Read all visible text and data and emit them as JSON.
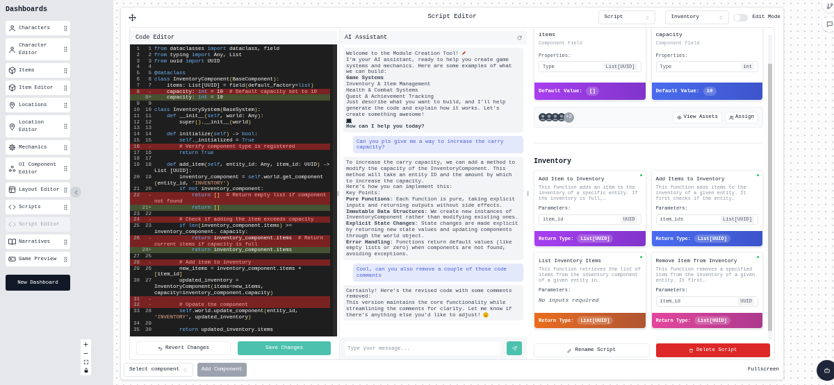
{
  "sidebar": {
    "title": "Dashboards",
    "items": [
      {
        "label": "Characters",
        "selected": false
      },
      {
        "label": "Character Editor",
        "selected": false
      },
      {
        "label": "Items",
        "selected": false
      },
      {
        "label": "Item Editor",
        "selected": false
      },
      {
        "label": "Locations",
        "selected": false
      },
      {
        "label": "Location Editor",
        "selected": false
      },
      {
        "label": "Mechanics",
        "selected": false
      },
      {
        "label": "UI Component Editor",
        "selected": false
      },
      {
        "label": "Layout Editor",
        "selected": false
      },
      {
        "label": "Scripts",
        "selected": false
      },
      {
        "label": "Script Editor",
        "selected": true
      },
      {
        "label": "Narratives",
        "selected": false
      },
      {
        "label": "Game Preview",
        "selected": false
      }
    ],
    "new_button": "New Dashboard"
  },
  "window": {
    "title": "Script Editor",
    "selects": [
      "Script",
      "Inventory"
    ],
    "edit_mode": {
      "label": "Edit Mode",
      "on": false
    }
  },
  "code_editor": {
    "title": "Code Editor",
    "lines": [
      {
        "old": "1",
        "new": "1",
        "kind": "context",
        "code": [
          {
            "kind": "keyword",
            "text": "from"
          },
          {
            "kind": "plain",
            "text": " dataclasses "
          },
          {
            "kind": "keyword",
            "text": "import"
          },
          {
            "kind": "plain",
            "text": " dataclass, field"
          }
        ]
      },
      {
        "old": "2",
        "new": "2",
        "kind": "context",
        "code": [
          {
            "kind": "keyword",
            "text": "from"
          },
          {
            "kind": "plain",
            "text": " typing "
          },
          {
            "kind": "keyword",
            "text": "import"
          },
          {
            "kind": "plain",
            "text": " Any, List"
          }
        ]
      },
      {
        "old": "3",
        "new": "3",
        "kind": "context",
        "code": [
          {
            "kind": "keyword",
            "text": "from"
          },
          {
            "kind": "plain",
            "text": " uuid "
          },
          {
            "kind": "keyword",
            "text": "import"
          },
          {
            "kind": "plain",
            "text": " UUID"
          }
        ]
      },
      {
        "old": "4",
        "new": "4",
        "kind": "context"
      },
      {
        "old": "5",
        "new": "5",
        "kind": "context",
        "code": [
          {
            "kind": "keyword",
            "text": "@dataclass"
          }
        ]
      },
      {
        "old": "6",
        "new": "6",
        "kind": "context",
        "code": [
          {
            "kind": "keyword",
            "text": "class"
          },
          {
            "kind": "plain",
            "text": " InventoryComponent"
          },
          {
            "kind": "bracket",
            "text": "("
          },
          {
            "kind": "plain",
            "text": "BaseComponent"
          },
          {
            "kind": "bracket",
            "text": ")"
          },
          {
            "kind": "plain",
            "text": ":"
          }
        ]
      },
      {
        "old": "7",
        "new": "7",
        "kind": "context",
        "code": [
          {
            "kind": "plain",
            "text": "    items: List[UUID] = field"
          },
          {
            "kind": "bracket",
            "text": "("
          },
          {
            "kind": "plain",
            "text": "default_factory="
          },
          {
            "kind": "keyword",
            "text": "list"
          },
          {
            "kind": "bracket",
            "text": ")"
          }
        ]
      },
      {
        "old": "8",
        "new": "-",
        "kind": "removed",
        "code": [
          {
            "kind": "plain",
            "text": "    capacity: "
          },
          {
            "kind": "keyword",
            "text": "int"
          },
          {
            "kind": "plain",
            "text": " = 10  "
          },
          {
            "kind": "comment",
            "text": "# Default capacity set to 10"
          }
        ]
      },
      {
        "new": "8+",
        "kind": "added",
        "code": [
          {
            "kind": "plain",
            "text": "    capacity: "
          },
          {
            "kind": "keyword",
            "text": "int"
          },
          {
            "kind": "plain",
            "text": " = 10"
          }
        ]
      },
      {
        "old": "9",
        "new": "9",
        "kind": "context"
      },
      {
        "old": "10",
        "new": "10",
        "kind": "context",
        "code": [
          {
            "kind": "keyword",
            "text": "class"
          },
          {
            "kind": "plain",
            "text": " InventorySystem"
          },
          {
            "kind": "bracket",
            "text": "("
          },
          {
            "kind": "plain",
            "text": "BaseSystem"
          },
          {
            "kind": "bracket",
            "text": ")"
          },
          {
            "kind": "plain",
            "text": ":"
          }
        ]
      },
      {
        "old": "11",
        "new": "11",
        "kind": "context",
        "code": [
          {
            "kind": "keyword",
            "text": "    def"
          },
          {
            "kind": "plain",
            "text": " __init__"
          },
          {
            "kind": "bracket",
            "text": "("
          },
          {
            "kind": "keyword",
            "text": "self"
          },
          {
            "kind": "plain",
            "text": ", world: Any"
          },
          {
            "kind": "bracket",
            "text": ")"
          },
          {
            "kind": "plain",
            "text": ":"
          }
        ]
      },
      {
        "old": "12",
        "new": "12",
        "kind": "context",
        "code": [
          {
            "kind": "plain",
            "text": "        super"
          },
          {
            "kind": "bracket",
            "text": "()"
          },
          {
            "kind": "plain",
            "text": ".__init__"
          },
          {
            "kind": "bracket",
            "text": "("
          },
          {
            "kind": "plain",
            "text": "world"
          },
          {
            "kind": "bracket",
            "text": ")"
          }
        ]
      },
      {
        "old": "13",
        "new": "13",
        "kind": "context"
      },
      {
        "old": "14",
        "new": "14",
        "kind": "context",
        "code": [
          {
            "kind": "keyword",
            "text": "    def"
          },
          {
            "kind": "plain",
            "text": " initialize"
          },
          {
            "kind": "bracket",
            "text": "("
          },
          {
            "kind": "keyword",
            "text": "self"
          },
          {
            "kind": "bracket",
            "text": ")"
          },
          {
            "kind": "plain",
            "text": " -> "
          },
          {
            "kind": "keyword",
            "text": "bool"
          },
          {
            "kind": "plain",
            "text": ":"
          }
        ]
      },
      {
        "old": "15",
        "new": "15",
        "kind": "context",
        "code": [
          {
            "kind": "keyword",
            "text": "        self"
          },
          {
            "kind": "plain",
            "text": "._initialized = "
          },
          {
            "kind": "keyword",
            "text": "True"
          }
        ]
      },
      {
        "old": "16",
        "new": "-",
        "kind": "removed",
        "code": [
          {
            "kind": "comment",
            "text": "        # Verify component type is registered"
          }
        ]
      },
      {
        "old": "17",
        "new": "16",
        "kind": "context",
        "code": [
          {
            "kind": "keyword",
            "text": "        return True"
          }
        ]
      },
      {
        "old": "18",
        "new": "17",
        "kind": "context"
      },
      {
        "old": "19",
        "new": "18",
        "kind": "context",
        "code": [
          {
            "kind": "keyword",
            "text": "    def"
          },
          {
            "kind": "plain",
            "text": " add_item"
          },
          {
            "kind": "bracket",
            "text": "("
          },
          {
            "kind": "keyword",
            "text": "self"
          },
          {
            "kind": "plain",
            "text": ", entity_id: Any, item_id: UUID"
          },
          {
            "kind": "bracket",
            "text": ")"
          },
          {
            "kind": "plain",
            "text": " -> List [UUID]:"
          }
        ]
      },
      {
        "old": "20",
        "new": "19",
        "kind": "context",
        "code": [
          {
            "kind": "plain",
            "text": "        inventory_component = "
          },
          {
            "kind": "keyword",
            "text": "self"
          },
          {
            "kind": "plain",
            "text": ".world.get_component "
          },
          {
            "kind": "bracket",
            "text": "("
          },
          {
            "kind": "plain",
            "text": "entity_id, "
          },
          {
            "kind": "string",
            "text": "'INVENTORY'"
          },
          {
            "kind": "bracket",
            "text": ")"
          }
        ]
      },
      {
        "old": "21",
        "new": "20",
        "kind": "context",
        "code": [
          {
            "kind": "keyword",
            "text": "        if not"
          },
          {
            "kind": "plain",
            "text": " inventory_component:"
          }
        ]
      },
      {
        "old": "22",
        "new": "-",
        "kind": "removed",
        "code": [
          {
            "kind": "keyword",
            "text": "            return"
          },
          {
            "kind": "bracket",
            "text": " []"
          },
          {
            "kind": "comment",
            "text": "  # Return empty list if component not found"
          }
        ]
      },
      {
        "new": "21+",
        "kind": "added",
        "code": [
          {
            "kind": "keyword",
            "text": "            return"
          },
          {
            "kind": "bracket",
            "text": " []"
          }
        ]
      },
      {
        "old": "23",
        "new": "22",
        "kind": "context"
      },
      {
        "old": "24",
        "new": "-",
        "kind": "removed",
        "code": [
          {
            "kind": "comment",
            "text": "        # Check if adding the item exceeds capacity"
          }
        ]
      },
      {
        "old": "25",
        "new": "23",
        "kind": "context",
        "code": [
          {
            "kind": "keyword",
            "text": "        if len"
          },
          {
            "kind": "bracket",
            "text": "("
          },
          {
            "kind": "plain",
            "text": "inventory_component.items"
          },
          {
            "kind": "bracket",
            "text": ")"
          },
          {
            "kind": "plain",
            "text": " >= inventory_component. capacity:"
          }
        ]
      },
      {
        "old": "26",
        "new": "-",
        "kind": "removed",
        "code": [
          {
            "kind": "keyword",
            "text": "            return"
          },
          {
            "kind": "plain",
            "text": " inventory_component.items"
          },
          {
            "kind": "comment",
            "text": "  # Return current items if capacity is full"
          }
        ]
      },
      {
        "new": "24+",
        "kind": "added",
        "code": [
          {
            "kind": "keyword",
            "text": "            return"
          },
          {
            "kind": "plain",
            "text": " inventory_component.items"
          }
        ]
      },
      {
        "old": "27",
        "new": "25",
        "kind": "context"
      },
      {
        "old": "28",
        "new": "-",
        "kind": "removed",
        "code": [
          {
            "kind": "comment",
            "text": "        # Add item to inventory"
          }
        ]
      },
      {
        "old": "29",
        "new": "26",
        "kind": "context",
        "code": [
          {
            "kind": "plain",
            "text": "        new_items = inventory_component.items + "
          },
          {
            "kind": "bracket",
            "text": "["
          },
          {
            "kind": "plain",
            "text": "item_id"
          },
          {
            "kind": "bracket",
            "text": "]"
          }
        ]
      },
      {
        "old": "30",
        "new": "27",
        "kind": "context",
        "code": [
          {
            "kind": "plain",
            "text": "        updated_inventory = InventoryComponent"
          },
          {
            "kind": "bracket",
            "text": "("
          },
          {
            "kind": "plain",
            "text": "items=new_items, capacity=inventory_component.capacity"
          },
          {
            "kind": "bracket",
            "text": ")"
          }
        ]
      },
      {
        "old": "31",
        "new": "-",
        "kind": "removed"
      },
      {
        "old": "32",
        "new": "-",
        "kind": "removed",
        "code": [
          {
            "kind": "comment",
            "text": "        # Update the component"
          }
        ]
      },
      {
        "old": "33",
        "new": "28",
        "kind": "context",
        "code": [
          {
            "kind": "keyword",
            "text": "        self"
          },
          {
            "kind": "plain",
            "text": ".world.update_component"
          },
          {
            "kind": "bracket",
            "text": "("
          },
          {
            "kind": "plain",
            "text": "entity_id, "
          },
          {
            "kind": "string",
            "text": "'INVENTORY'"
          },
          {
            "kind": "plain",
            "text": ", updated_inventory"
          },
          {
            "kind": "bracket",
            "text": ")"
          }
        ]
      },
      {
        "old": "34",
        "new": "29",
        "kind": "context"
      },
      {
        "old": "35",
        "new": "30",
        "kind": "context",
        "code": [
          {
            "kind": "keyword",
            "text": "        return"
          },
          {
            "kind": "plain",
            "text": " updated_inventory.items"
          }
        ]
      }
    ],
    "buttons": [
      "Revert Changes",
      "Save Changes"
    ]
  },
  "ai_assistant": {
    "title": "AI Assistant",
    "messages": [
      {
        "kind": "assistant",
        "paragraphs": [
          {
            "kind": "text",
            "text": "Welcome to the Module Creation Tool!",
            "emoji": true
          },
          {
            "kind": "text",
            "text": "I'm your AI assistant, ready to help you create game systems and mechanics. Here are some examples of what we can build:"
          },
          {
            "kind": "heading",
            "text": "Game Systems"
          },
          {
            "kind": "text",
            "text": "Inventory & Item Management"
          },
          {
            "kind": "text",
            "text": "Health & Combat Systems"
          },
          {
            "kind": "text",
            "text": "Quest & Achievement Tracking"
          },
          {
            "kind": "text",
            "text": "Just describe what you want to build, and I'll help generate the code and explain how it works. Let's create something awesome!",
            "emoji": true
          },
          {
            "kind": "heading",
            "text": "How can I help you today?"
          }
        ]
      },
      {
        "kind": "user",
        "paragraphs": [
          {
            "kind": "text",
            "text": "Can you pls give me a way to increase the carry capacity?"
          }
        ]
      },
      {
        "kind": "assistant",
        "paragraphs": [
          {
            "kind": "text",
            "text": "To increase the carry capacity, we can add a method to modify the capacity of the InventoryComponent. This method will take an entity ID and the amount by which to increase the capacity."
          },
          {
            "kind": "text",
            "text": "Here's how you can implement this:"
          },
          {
            "kind": "text",
            "text": "Key Points:"
          },
          {
            "kind": "text",
            "text": "**Pure Functions**: Each function is pure, taking explicit inputs and returning outputs without side effects."
          },
          {
            "kind": "text",
            "text": "**Immutable Data Structures**: We create new instances of InventoryComponent rather than modifying existing ones."
          },
          {
            "kind": "text",
            "text": "**Explicit State Changes**: State changes are made explicit by returning new state values and updating components through the world object."
          },
          {
            "kind": "text",
            "text": "**Error Handling**: Functions return default values (like empty lists or zero) when components are not found, avoiding exceptions."
          }
        ]
      },
      {
        "kind": "user",
        "paragraphs": [
          {
            "kind": "text",
            "text": "Cool, can you also remove a couple of those code comments"
          }
        ]
      },
      {
        "kind": "assistant",
        "paragraphs": [
          {
            "kind": "text",
            "text": "Certainly! Here's the revised code with some comments removed:"
          },
          {
            "kind": "text",
            "text": "This version maintains the core functionality while streamlining the comments for clarity. Let me know if there's anything else you'd like to adjust!",
            "emoji": true
          }
        ]
      }
    ],
    "input": {
      "placeholder": "Type your message..."
    }
  },
  "script_panel": {
    "fields": [
      {
        "name": "items",
        "subtitle": "Component Field",
        "properties_label": "Properties:",
        "property": "Type",
        "type": "List[UUID]",
        "default_label": "Default Value:",
        "default": "[]",
        "color": "#a83ff0"
      },
      {
        "name": "capacity",
        "subtitle": "Component Field",
        "properties_label": "Properties:",
        "property": "Type",
        "type": "int",
        "default_label": "Default Value:",
        "default": "10",
        "color": "#4a6cf0"
      }
    ],
    "assets": {
      "extra": "+2",
      "buttons": [
        "View Assets",
        "Assign"
      ]
    },
    "section": "Inventory",
    "functions": [
      {
        "name": "Add Item to Inventory",
        "description": "This function adds an item to the inventory of a specific entity. If the inventory is full,…",
        "parameters_label": "Parameters:",
        "parameters": [
          {
            "name": "item_id",
            "type": "UUID"
          }
        ],
        "return_label": "Return Type:",
        "return_type": "List[UUID]",
        "color": "#a83ff0"
      },
      {
        "name": "Add Items to Inventory",
        "description": "This function adds items to the inventory of a given entity. It first checks if the entity…",
        "parameters_label": "Parameters:",
        "parameters": [
          {
            "name": "item_ids",
            "type": "List[UUID]"
          }
        ],
        "return_label": "Return Type:",
        "return_type": "List[UUID]",
        "color": "#4a6cf0"
      },
      {
        "name": "List Inventory Items",
        "description": "This function retrieves the list of items from the inventory component of a given entity in…",
        "parameters_label": "Parameters:",
        "no_parameters": "No inputs required",
        "return_label": "Return Type:",
        "return_type": "List[UUID]",
        "color": "#ea6c1c"
      },
      {
        "name": "Remove Item from Inventory",
        "description": "This function removes a specified item from the inventory of a given entity. It first…",
        "parameters_label": "Parameters:",
        "parameters": [
          {
            "name": "item_id",
            "type": "UUID"
          }
        ],
        "return_label": "Return Type:",
        "return_type": "List[UUID]",
        "color": "#e4469c"
      }
    ],
    "buttons": [
      "Rename Script",
      "Delete Script"
    ]
  },
  "bottom_bar": {
    "select": "Select component",
    "add": "Add Component",
    "fullscreen": "Fullscreen"
  }
}
